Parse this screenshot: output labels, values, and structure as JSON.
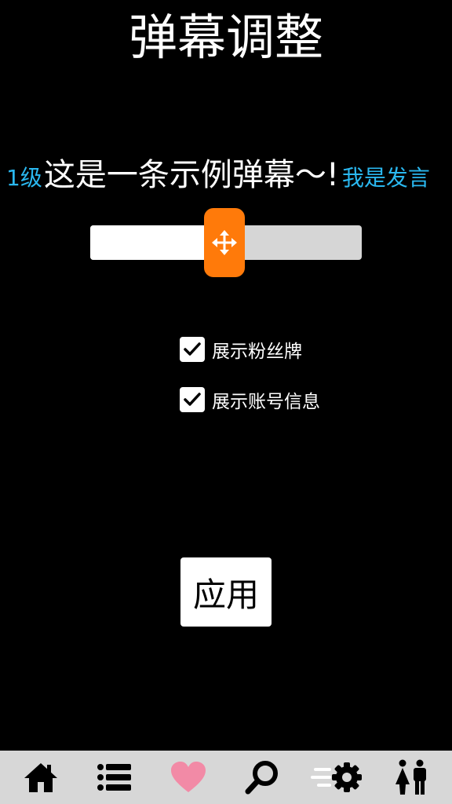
{
  "page": {
    "title": "弹幕调整"
  },
  "preview": {
    "level": "1级",
    "message": "这是一条示例弹幕～!",
    "username": "我是发言"
  },
  "slider": {
    "value": 0.5,
    "handle_icon": "move-arrows-icon"
  },
  "options": [
    {
      "label": "展示粉丝牌",
      "checked": true
    },
    {
      "label": "展示账号信息",
      "checked": true
    }
  ],
  "apply_button": {
    "label": "应用"
  },
  "navbar": {
    "items": [
      {
        "icon": "home-icon"
      },
      {
        "icon": "list-icon"
      },
      {
        "icon": "heart-icon",
        "active": true
      },
      {
        "icon": "search-icon"
      },
      {
        "icon": "danmaku-settings-icon"
      },
      {
        "icon": "people-icon"
      }
    ]
  },
  "colors": {
    "background": "#000000",
    "accent_orange": "#ff7a0a",
    "accent_blue": "#2ab8f0",
    "heart_pink": "#f28aa6",
    "navbar_bg": "#d7d7d7"
  }
}
